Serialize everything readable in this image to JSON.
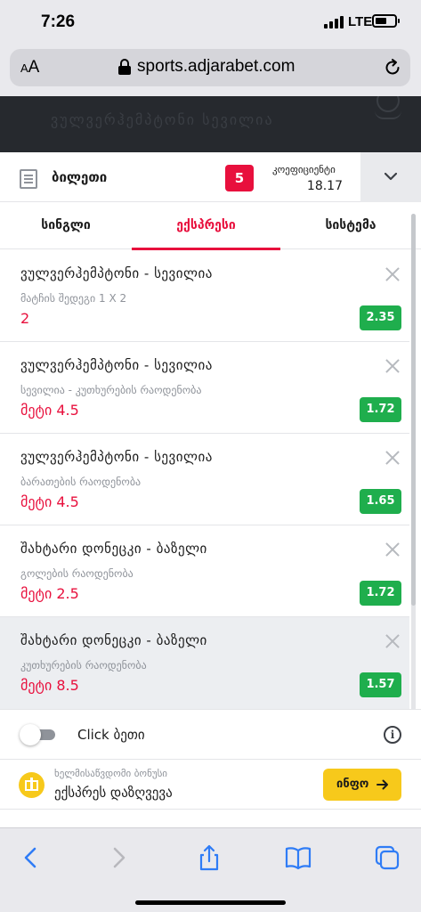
{
  "status": {
    "time": "7:26",
    "network": "LTE"
  },
  "browser": {
    "text_size_label": "A",
    "text_size_label_big": "A",
    "url": "sports.adjarabet.com"
  },
  "header": {
    "ghost_text": "ვულვერჰემპტონი სევილია"
  },
  "slip": {
    "title": "ბილეთი",
    "count": "5",
    "coef_label": "კოეფიციენტი",
    "coef_value": "18.17"
  },
  "tabs": [
    {
      "label": "სინგლი",
      "active": false
    },
    {
      "label": "ექსპრესი",
      "active": true
    },
    {
      "label": "სისტემა",
      "active": false
    }
  ],
  "bets": [
    {
      "match": "ვულვერჰემპტონი - სევილია",
      "market": "მატჩის შედეგი 1 X 2",
      "pick": "2",
      "odd": "2.35",
      "highlighted": false
    },
    {
      "match": "ვულვერჰემპტონი - სევილია",
      "market": "სევილია - კუთხურების რაოდენობა",
      "pick": "მეტი 4.5",
      "odd": "1.72",
      "highlighted": false
    },
    {
      "match": "ვულვერჰემპტონი - სევილია",
      "market": "ბარათების რაოდენობა",
      "pick": "მეტი 4.5",
      "odd": "1.65",
      "highlighted": false
    },
    {
      "match": "შახტარი დონეცკი - ბაზელი",
      "market": "გოლების რაოდენობა",
      "pick": "მეტი 2.5",
      "odd": "1.72",
      "highlighted": false
    },
    {
      "match": "შახტარი დონეცკი - ბაზელი",
      "market": "კუთხურების რაოდენობა",
      "pick": "მეტი 8.5",
      "odd": "1.57",
      "highlighted": true
    }
  ],
  "click_bet": {
    "label": "Click ბეთი",
    "enabled": false
  },
  "bonus": {
    "title": "ხელმისაწვდომი ბონუსი",
    "subtitle": "ექსპრეს დაზღვევა",
    "button": "ინფო"
  },
  "colors": {
    "accent": "#e8103d",
    "odd_bg": "#1fae4d",
    "bonus_yellow": "#f7c91b",
    "dark_header": "#26292e",
    "ios_blue": "#2f7cf6"
  },
  "toolbar_icons": [
    "back-icon",
    "forward-icon",
    "share-icon",
    "bookmarks-icon",
    "tabs-icon"
  ]
}
